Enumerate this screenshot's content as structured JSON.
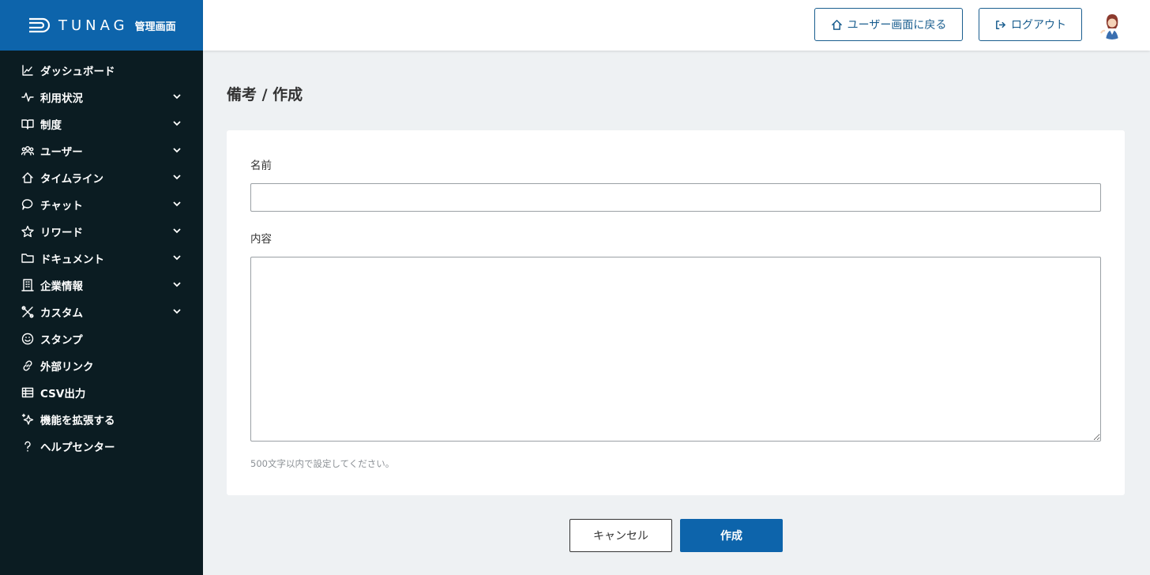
{
  "brand": {
    "logo_text": "TUNAG",
    "admin_label": "管理画面",
    "color": "#0d64ab"
  },
  "sidebar": {
    "items": [
      {
        "label": "ダッシュボード",
        "icon": "chart-icon",
        "expandable": false
      },
      {
        "label": "利用状況",
        "icon": "pulse-icon",
        "expandable": true
      },
      {
        "label": "制度",
        "icon": "book-icon",
        "expandable": true
      },
      {
        "label": "ユーザー",
        "icon": "users-icon",
        "expandable": true
      },
      {
        "label": "タイムライン",
        "icon": "home-icon",
        "expandable": true
      },
      {
        "label": "チャット",
        "icon": "chat-bubble-icon",
        "expandable": true
      },
      {
        "label": "リワード",
        "icon": "star-icon",
        "expandable": true
      },
      {
        "label": "ドキュメント",
        "icon": "folder-icon",
        "expandable": true
      },
      {
        "label": "企業情報",
        "icon": "building-icon",
        "expandable": true
      },
      {
        "label": "カスタム",
        "icon": "tools-icon",
        "expandable": true
      },
      {
        "label": "スタンプ",
        "icon": "smile-icon",
        "expandable": false
      },
      {
        "label": "外部リンク",
        "icon": "link-icon",
        "expandable": false
      },
      {
        "label": "CSV出力",
        "icon": "table-icon",
        "expandable": false
      },
      {
        "label": "機能を拡張する",
        "icon": "sparkle-icon",
        "expandable": false
      },
      {
        "label": "ヘルプセンター",
        "icon": "help-icon",
        "expandable": false
      }
    ]
  },
  "header": {
    "user_screen_label": "ユーザー画面に戻る",
    "logout_label": "ログアウト"
  },
  "main": {
    "page_title": "備考 / 作成",
    "form": {
      "name_label": "名前",
      "name_value": "",
      "content_label": "内容",
      "content_value": "",
      "hint": "500文字以内で設定してください。"
    },
    "cancel_label": "キャンセル",
    "create_label": "作成"
  }
}
